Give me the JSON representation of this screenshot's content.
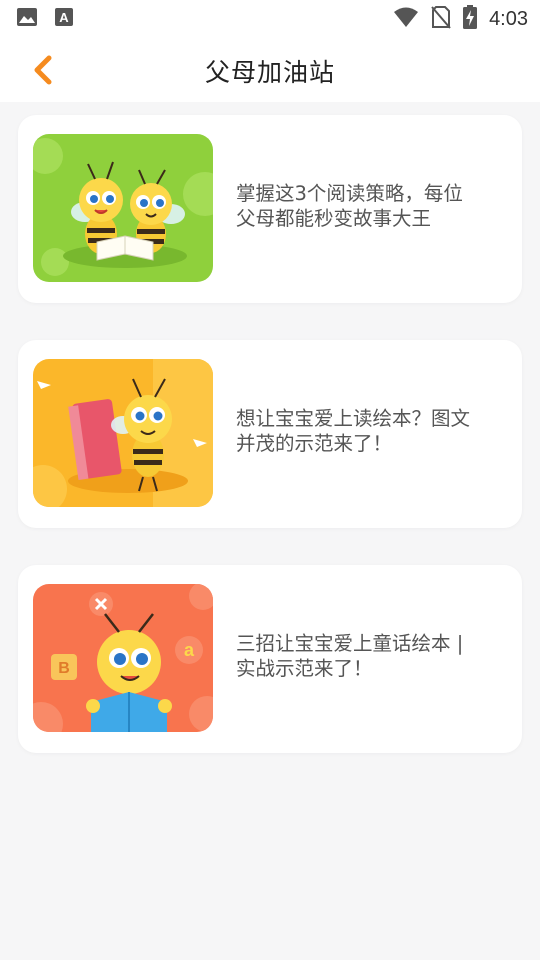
{
  "status_bar": {
    "time": "4:03"
  },
  "header": {
    "title": "父母加油站"
  },
  "colors": {
    "accent_orange": "#f58b1f",
    "card_bg": "#ffffff",
    "page_bg": "#f6f6f7"
  },
  "articles": [
    {
      "title": "掌握这3个阅读策略，每位\n父母都能秒变故事大王",
      "thumb_bg": "#8fd03c"
    },
    {
      "title": "想让宝宝爱上读绘本？图文\n并茂的示范来了！",
      "thumb_bg": "#fbb72a"
    },
    {
      "title": "三招让宝宝爱上童话绘本 |\n实战示范来了！",
      "thumb_bg": "#f8744e"
    }
  ]
}
